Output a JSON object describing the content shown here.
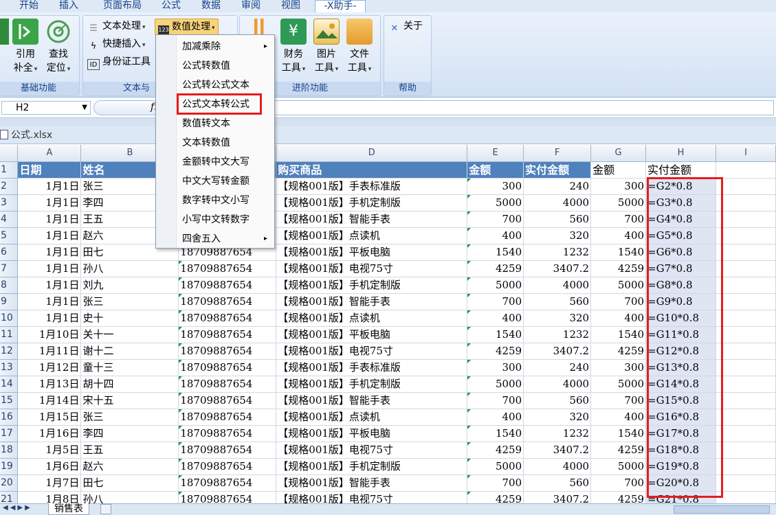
{
  "tabs": [
    "开始",
    "插入",
    "页面布局",
    "公式",
    "数据",
    "审阅",
    "视图",
    "-X助手-"
  ],
  "groups": {
    "basic": {
      "label": "基础功能",
      "btn1": [
        "引用",
        "补全"
      ],
      "btn2": [
        "查找",
        "定位"
      ]
    },
    "text": {
      "label": "文本与",
      "items": [
        "文本处理",
        "快捷插入",
        "身份证工具"
      ],
      "numeric_btn": "数值处理"
    },
    "advanced": {
      "label": "进阶功能",
      "btns": [
        [
          "财务",
          "工具"
        ],
        [
          "图片",
          "工具"
        ],
        [
          "文件",
          "工具"
        ]
      ]
    },
    "help": {
      "label": "帮助",
      "about": "关于"
    }
  },
  "name_box": "H2",
  "fx_label": "fx",
  "file_tab": "公式.xlsx",
  "menu": {
    "items": [
      "加减乘除",
      "公式转数值",
      "公式转公式文本",
      "公式文本转公式",
      "数值转文本",
      "文本转数值",
      "金额转中文大写",
      "中文大写转金额",
      "数字转中文小写",
      "小写中文转数字",
      "四舍五入"
    ],
    "submenu_arrow": "▸"
  },
  "columns": [
    "A",
    "B",
    "C",
    "D",
    "E",
    "F",
    "G",
    "H",
    "I"
  ],
  "header_row": {
    "date": "日期",
    "name": "姓名",
    "product": "购买商品",
    "amount": "金额",
    "paid": "实付金额",
    "amount2": "金额",
    "paid2": "实付金额"
  },
  "rows": [
    {
      "n": "2",
      "date": "1月1日",
      "name": "张三",
      "phone": "",
      "product": "【规格001版】手表标准版",
      "amt": "300",
      "paid": "240",
      "g": "300",
      "h": "=G2*0.8"
    },
    {
      "n": "3",
      "date": "1月1日",
      "name": "李四",
      "phone": "",
      "product": "【规格001版】手机定制版",
      "amt": "5000",
      "paid": "4000",
      "g": "5000",
      "h": "=G3*0.8"
    },
    {
      "n": "4",
      "date": "1月1日",
      "name": "王五",
      "phone": "",
      "product": "【规格001版】智能手表",
      "amt": "700",
      "paid": "560",
      "g": "700",
      "h": "=G4*0.8"
    },
    {
      "n": "5",
      "date": "1月1日",
      "name": "赵六",
      "phone": "",
      "product": "【规格001版】点读机",
      "amt": "400",
      "paid": "320",
      "g": "400",
      "h": "=G5*0.8"
    },
    {
      "n": "6",
      "date": "1月1日",
      "name": "田七",
      "phone": "18709887654",
      "product": "【规格001版】平板电脑",
      "amt": "1540",
      "paid": "1232",
      "g": "1540",
      "h": "=G6*0.8"
    },
    {
      "n": "7",
      "date": "1月1日",
      "name": "孙八",
      "phone": "18709887654",
      "product": "【规格001版】电视75寸",
      "amt": "4259",
      "paid": "3407.2",
      "g": "4259",
      "h": "=G7*0.8"
    },
    {
      "n": "8",
      "date": "1月1日",
      "name": "刘九",
      "phone": "18709887654",
      "product": "【规格001版】手机定制版",
      "amt": "5000",
      "paid": "4000",
      "g": "5000",
      "h": "=G8*0.8"
    },
    {
      "n": "9",
      "date": "1月1日",
      "name": "张三",
      "phone": "18709887654",
      "product": "【规格001版】智能手表",
      "amt": "700",
      "paid": "560",
      "g": "700",
      "h": "=G9*0.8"
    },
    {
      "n": "10",
      "date": "1月1日",
      "name": "史十",
      "phone": "18709887654",
      "product": "【规格001版】点读机",
      "amt": "400",
      "paid": "320",
      "g": "400",
      "h": "=G10*0.8"
    },
    {
      "n": "11",
      "date": "1月10日",
      "name": "关十一",
      "phone": "18709887654",
      "product": "【规格001版】平板电脑",
      "amt": "1540",
      "paid": "1232",
      "g": "1540",
      "h": "=G11*0.8"
    },
    {
      "n": "12",
      "date": "1月11日",
      "name": "谢十二",
      "phone": "18709887654",
      "product": "【规格001版】电视75寸",
      "amt": "4259",
      "paid": "3407.2",
      "g": "4259",
      "h": "=G12*0.8"
    },
    {
      "n": "13",
      "date": "1月12日",
      "name": "童十三",
      "phone": "18709887654",
      "product": "【规格001版】手表标准版",
      "amt": "300",
      "paid": "240",
      "g": "300",
      "h": "=G13*0.8"
    },
    {
      "n": "14",
      "date": "1月13日",
      "name": "胡十四",
      "phone": "18709887654",
      "product": "【规格001版】手机定制版",
      "amt": "5000",
      "paid": "4000",
      "g": "5000",
      "h": "=G14*0.8"
    },
    {
      "n": "15",
      "date": "1月14日",
      "name": "宋十五",
      "phone": "18709887654",
      "product": "【规格001版】智能手表",
      "amt": "700",
      "paid": "560",
      "g": "700",
      "h": "=G15*0.8"
    },
    {
      "n": "16",
      "date": "1月15日",
      "name": "张三",
      "phone": "18709887654",
      "product": "【规格001版】点读机",
      "amt": "400",
      "paid": "320",
      "g": "400",
      "h": "=G16*0.8"
    },
    {
      "n": "17",
      "date": "1月16日",
      "name": "李四",
      "phone": "18709887654",
      "product": "【规格001版】平板电脑",
      "amt": "1540",
      "paid": "1232",
      "g": "1540",
      "h": "=G17*0.8"
    },
    {
      "n": "18",
      "date": "1月5日",
      "name": "王五",
      "phone": "18709887654",
      "product": "【规格001版】电视75寸",
      "amt": "4259",
      "paid": "3407.2",
      "g": "4259",
      "h": "=G18*0.8"
    },
    {
      "n": "19",
      "date": "1月6日",
      "name": "赵六",
      "phone": "18709887654",
      "product": "【规格001版】手机定制版",
      "amt": "5000",
      "paid": "4000",
      "g": "5000",
      "h": "=G19*0.8"
    },
    {
      "n": "20",
      "date": "1月7日",
      "name": "田七",
      "phone": "18709887654",
      "product": "【规格001版】智能手表",
      "amt": "700",
      "paid": "560",
      "g": "700",
      "h": "=G20*0.8"
    },
    {
      "n": "21",
      "date": "1月8日",
      "name": "孙八",
      "phone": "18709887654",
      "product": "【规格001版】电视75寸",
      "amt": "4259",
      "paid": "3407.2",
      "g": "4259",
      "h": "=G21*0.8"
    }
  ],
  "sheet_tab": "销售表",
  "colors": {
    "accent": "#4f81bd",
    "highlight": "#e41c1c",
    "ribbon": "#d3e2f4"
  }
}
